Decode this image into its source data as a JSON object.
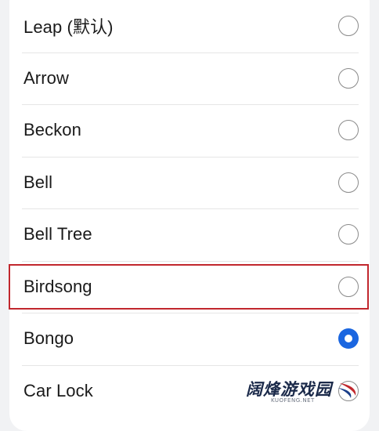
{
  "ringtones": {
    "items": [
      {
        "label": "Leap (默认)",
        "selected": false
      },
      {
        "label": "Arrow",
        "selected": false
      },
      {
        "label": "Beckon",
        "selected": false
      },
      {
        "label": "Bell",
        "selected": false
      },
      {
        "label": "Bell Tree",
        "selected": false
      },
      {
        "label": "Birdsong",
        "selected": false,
        "highlighted": true
      },
      {
        "label": "Bongo",
        "selected": true
      },
      {
        "label": "Car Lock",
        "selected": false
      }
    ]
  },
  "watermark": {
    "title": "阔烽游戏园",
    "subtitle": "KUOFENG.NET"
  },
  "colors": {
    "accent": "#1a66e0",
    "highlight": "#c1272d"
  }
}
